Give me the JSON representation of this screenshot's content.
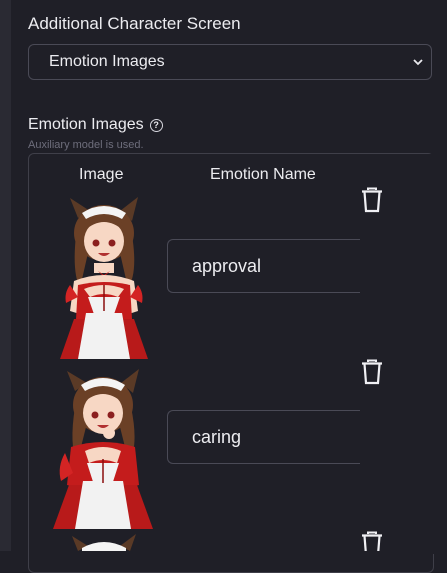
{
  "section": {
    "title": "Additional Character Screen"
  },
  "select": {
    "value": "Emotion Images"
  },
  "emotion_images": {
    "label": "Emotion Images",
    "help_icon": "question-circle-icon",
    "subtitle": "Auxiliary model is used.",
    "columns": {
      "image": "Image",
      "name": "Emotion Name"
    },
    "rows": [
      {
        "name": "approval"
      },
      {
        "name": "caring"
      }
    ]
  },
  "colors": {
    "background": "#1f1f27",
    "border": "#4a4a56",
    "text": "#ececf0",
    "muted": "#6e6e7c"
  }
}
